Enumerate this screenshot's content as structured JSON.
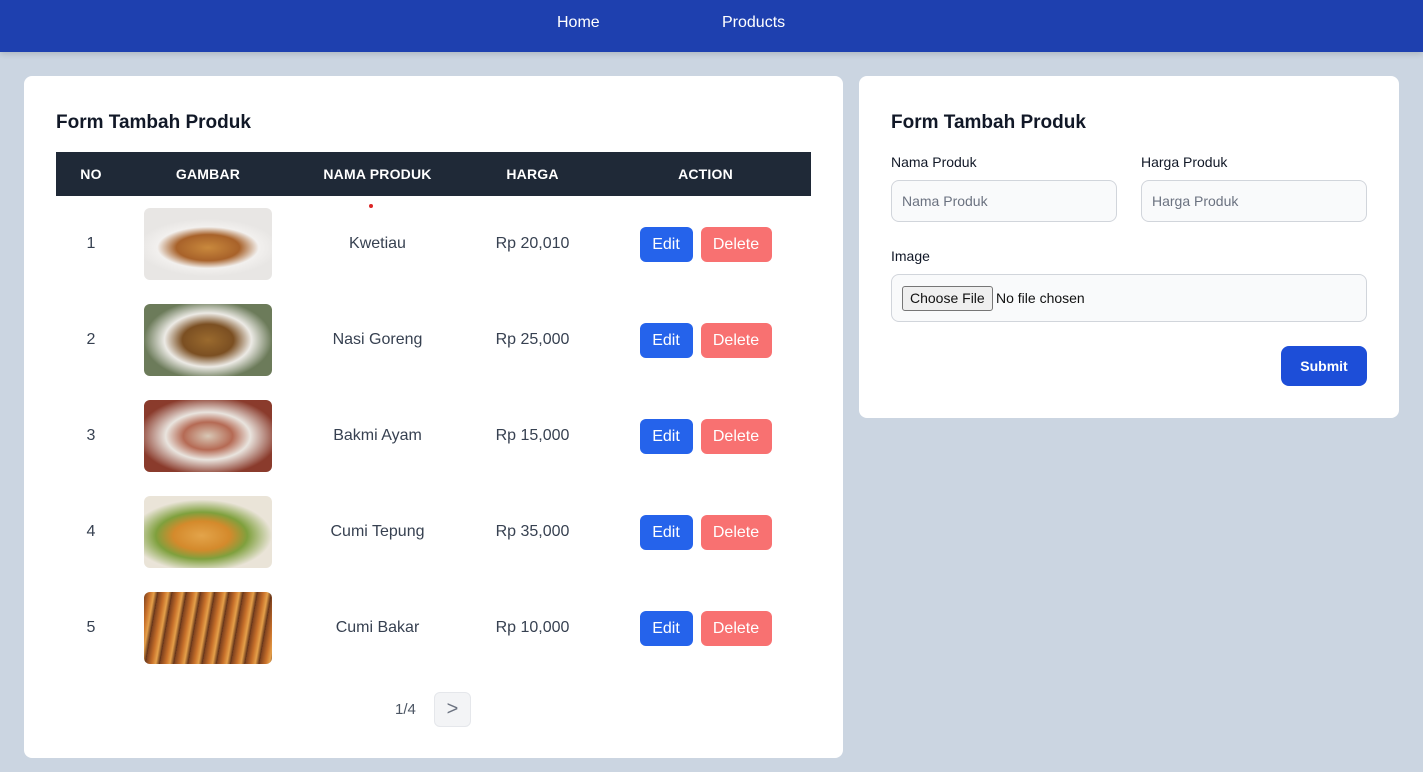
{
  "nav": {
    "home": "Home",
    "products": "Products"
  },
  "list_card": {
    "title": "Form Tambah Produk",
    "columns": [
      "NO",
      "GAMBAR",
      "NAMA PRODUK",
      "HARGA",
      "ACTION"
    ],
    "rows": [
      {
        "no": "1",
        "name": "Kwetiau",
        "price": "Rp 20,010",
        "image": "kwetiau-photo"
      },
      {
        "no": "2",
        "name": "Nasi Goreng",
        "price": "Rp 25,000",
        "image": "nasi-goreng-photo"
      },
      {
        "no": "3",
        "name": "Bakmi Ayam",
        "price": "Rp 15,000",
        "image": "bakmi-ayam-photo"
      },
      {
        "no": "4",
        "name": "Cumi Tepung",
        "price": "Rp 35,000",
        "image": "cumi-tepung-photo"
      },
      {
        "no": "5",
        "name": "Cumi Bakar",
        "price": "Rp 10,000",
        "image": "cumi-bakar-photo"
      }
    ],
    "edit_label": "Edit",
    "delete_label": "Delete",
    "pagination": {
      "info": "1/4",
      "next_label": ">"
    }
  },
  "form_card": {
    "title": "Form Tambah Produk",
    "name_label": "Nama Produk",
    "name_placeholder": "Nama Produk",
    "name_value": "",
    "price_label": "Harga Produk",
    "price_placeholder": "Harga Produk",
    "price_value": "",
    "image_label": "Image",
    "file_button_label": "Choose File",
    "file_status": "No file chosen",
    "submit_label": "Submit"
  },
  "colors": {
    "navbar": "#1e40af",
    "page_background": "#cbd5e1",
    "table_header": "#1f2937",
    "edit_button": "#2563eb",
    "delete_button": "#f87171",
    "submit_button": "#1d4ed8"
  }
}
